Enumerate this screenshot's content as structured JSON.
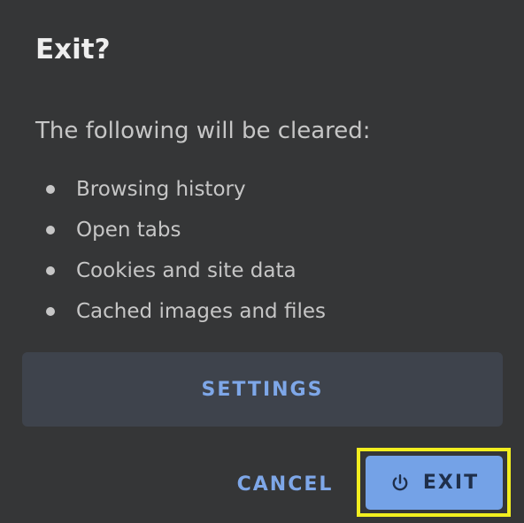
{
  "dialog": {
    "title": "Exit?",
    "subtitle": "The following will be cleared:",
    "items": [
      {
        "label": "Browsing history"
      },
      {
        "label": "Open tabs"
      },
      {
        "label": "Cookies and site data"
      },
      {
        "label": "Cached images and files"
      }
    ],
    "settings_label": "SETTINGS",
    "cancel_label": "CANCEL",
    "exit_label": "EXIT",
    "exit_icon": "power-icon"
  },
  "colors": {
    "dialog_background": "#353637",
    "accent": "#7ea7e8",
    "exit_button_fill": "#74a2e7",
    "highlight": "#f2ee1f"
  }
}
